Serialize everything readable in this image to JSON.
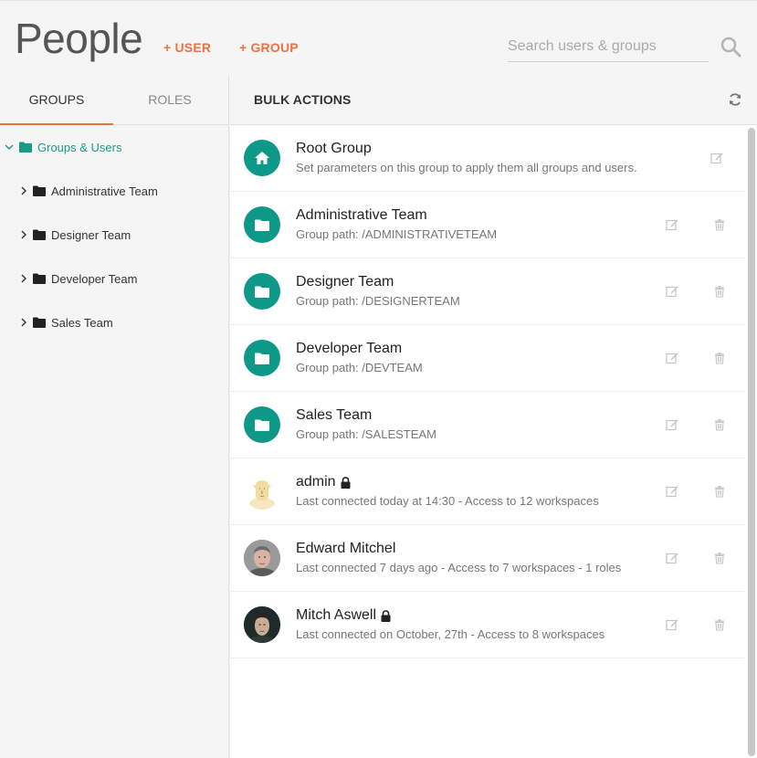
{
  "header": {
    "title": "People",
    "add_user": "+ USER",
    "add_group": "+ GROUP",
    "search_placeholder": "Search users & groups"
  },
  "left": {
    "tabs": [
      {
        "label": "GROUPS",
        "active": true
      },
      {
        "label": "ROLES",
        "active": false
      }
    ],
    "tree_root": "Groups & Users",
    "tree_items": [
      {
        "label": "Administrative Team"
      },
      {
        "label": "Designer Team"
      },
      {
        "label": "Developer Team"
      },
      {
        "label": "Sales Team"
      }
    ]
  },
  "right": {
    "bulk_actions": "BULK ACTIONS",
    "rows": [
      {
        "title": "Root Group",
        "subtitle": "Set parameters on this group to apply them all groups and users.",
        "icon": "home-icon",
        "locked": false
      },
      {
        "title": "Administrative Team",
        "subtitle": "Group path: /ADMINISTRATIVETEAM",
        "icon": "folder-icon",
        "locked": false
      },
      {
        "title": "Designer Team",
        "subtitle": "Group path: /DESIGNERTEAM",
        "icon": "folder-icon",
        "locked": false
      },
      {
        "title": "Developer Team",
        "subtitle": "Group path: /DEVTEAM",
        "icon": "folder-icon",
        "locked": false
      },
      {
        "title": "Sales Team",
        "subtitle": "Group path: /SALESTEAM",
        "icon": "folder-icon",
        "locked": false
      },
      {
        "title": "admin",
        "subtitle": "Last connected today at 14:30 - Access to 12 workspaces",
        "icon": "user-avatar",
        "locked": true
      },
      {
        "title": "Edward Mitchel",
        "subtitle": "Last connected 7 days ago - Access to 7 workspaces - 1 roles",
        "icon": "user-avatar",
        "locked": false
      },
      {
        "title": "Mitch Aswell",
        "subtitle": "Last connected on October, 27th - Access to 8 workspaces",
        "icon": "user-avatar",
        "locked": true
      }
    ]
  },
  "colors": {
    "accent": "#ee7142",
    "teal": "#0e9888",
    "tree_active": "#1a9b87"
  }
}
